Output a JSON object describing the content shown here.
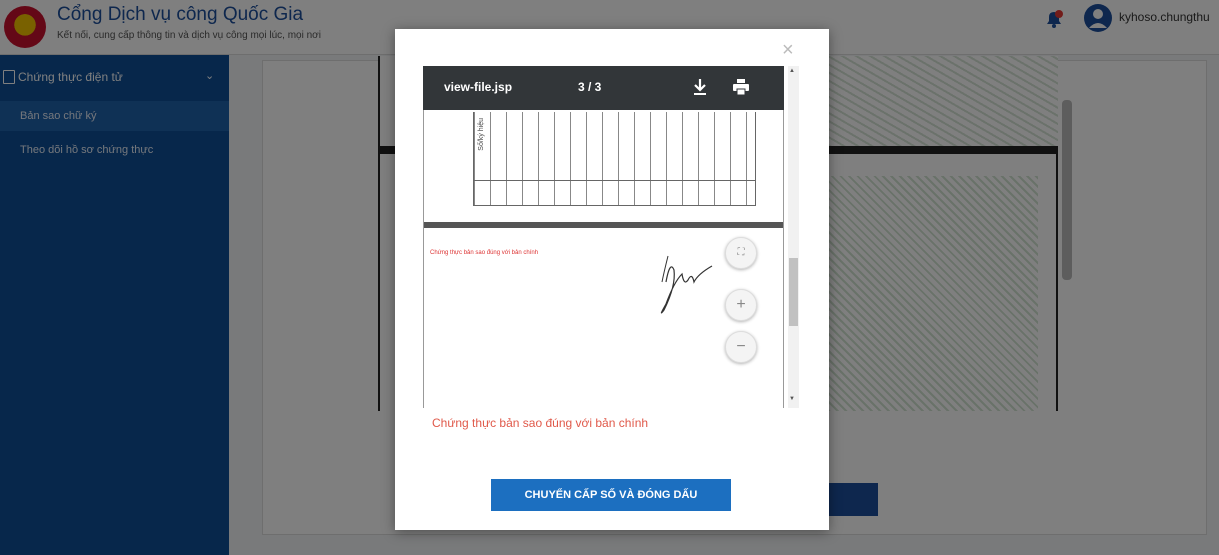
{
  "header": {
    "title": "Cổng Dịch vụ công Quốc Gia",
    "subtitle": "Kết nối, cung cấp thông tin và dịch vụ công mọi lúc, mọi nơi",
    "username": "kyhoso.chungthu",
    "icons": {
      "logo": "national-emblem",
      "notification": "bell-icon",
      "user": "user-avatar-icon"
    }
  },
  "sidebar": {
    "group_label": "Chứng thực điện tử",
    "items": [
      {
        "label": "Bản sao chữ ký",
        "active": true
      },
      {
        "label": "Theo dõi hồ sơ chứng thực",
        "active": false
      }
    ]
  },
  "modal": {
    "viewer": {
      "file_name": "view-file.jsp",
      "page_indicator": "3 / 3",
      "table_vertical_text": "Số/ký hiệu",
      "stamp_text": "Chứng thực bản sao đúng với bản chính"
    },
    "caption": "Chứng thực bản sao đúng với bản chính",
    "primary_button": "CHUYỂN CẤP SỐ VÀ ĐÓNG DẤU",
    "close_symbol": "×",
    "zoom": {
      "fit": "⛶",
      "in": "+",
      "out": "−"
    }
  },
  "colors": {
    "brand": "#1c4f9c",
    "sidebar": "#0e4f97",
    "button": "#1c6fc0",
    "caption": "#e0594a"
  }
}
